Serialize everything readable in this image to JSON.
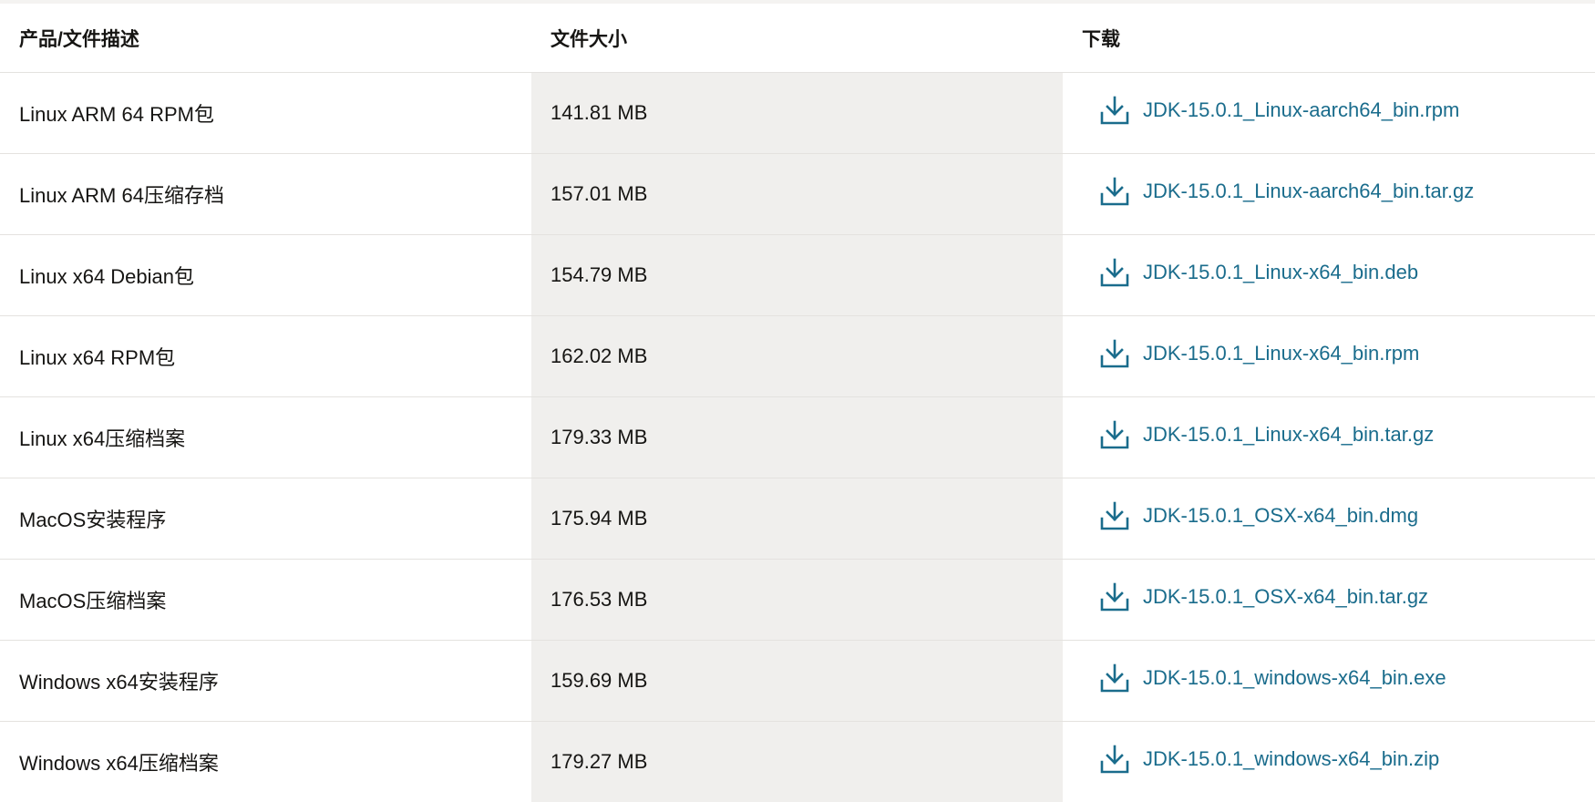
{
  "table": {
    "headers": {
      "description": "产品/文件描述",
      "size": "文件大小",
      "download": "下载"
    },
    "rows": [
      {
        "description": "Linux ARM 64 RPM包",
        "size": "141.81 MB",
        "file": "JDK-15.0.1_Linux-aarch64_bin.rpm"
      },
      {
        "description": "Linux ARM 64压缩存档",
        "size": "157.01 MB",
        "file": "JDK-15.0.1_Linux-aarch64_bin.tar.gz"
      },
      {
        "description": "Linux x64 Debian包",
        "size": "154.79 MB",
        "file": "JDK-15.0.1_Linux-x64_bin.deb"
      },
      {
        "description": "Linux x64 RPM包",
        "size": "162.02 MB",
        "file": "JDK-15.0.1_Linux-x64_bin.rpm"
      },
      {
        "description": "Linux x64压缩档案",
        "size": "179.33 MB",
        "file": "JDK-15.0.1_Linux-x64_bin.tar.gz"
      },
      {
        "description": "MacOS安装程序",
        "size": "175.94 MB",
        "file": "JDK-15.0.1_OSX-x64_bin.dmg"
      },
      {
        "description": "MacOS压缩档案",
        "size": "176.53 MB",
        "file": "JDK-15.0.1_OSX-x64_bin.tar.gz"
      },
      {
        "description": "Windows x64安装程序",
        "size": "159.69 MB",
        "file": "JDK-15.0.1_windows-x64_bin.exe"
      },
      {
        "description": "Windows x64压缩档案",
        "size": "179.27 MB",
        "file": "JDK-15.0.1_windows-x64_bin.zip"
      }
    ],
    "icon": "download-icon"
  },
  "colors": {
    "link": "#1a6c8c",
    "size_column_bg": "#f0efed",
    "divider": "#e4e2df",
    "text": "#161513"
  }
}
